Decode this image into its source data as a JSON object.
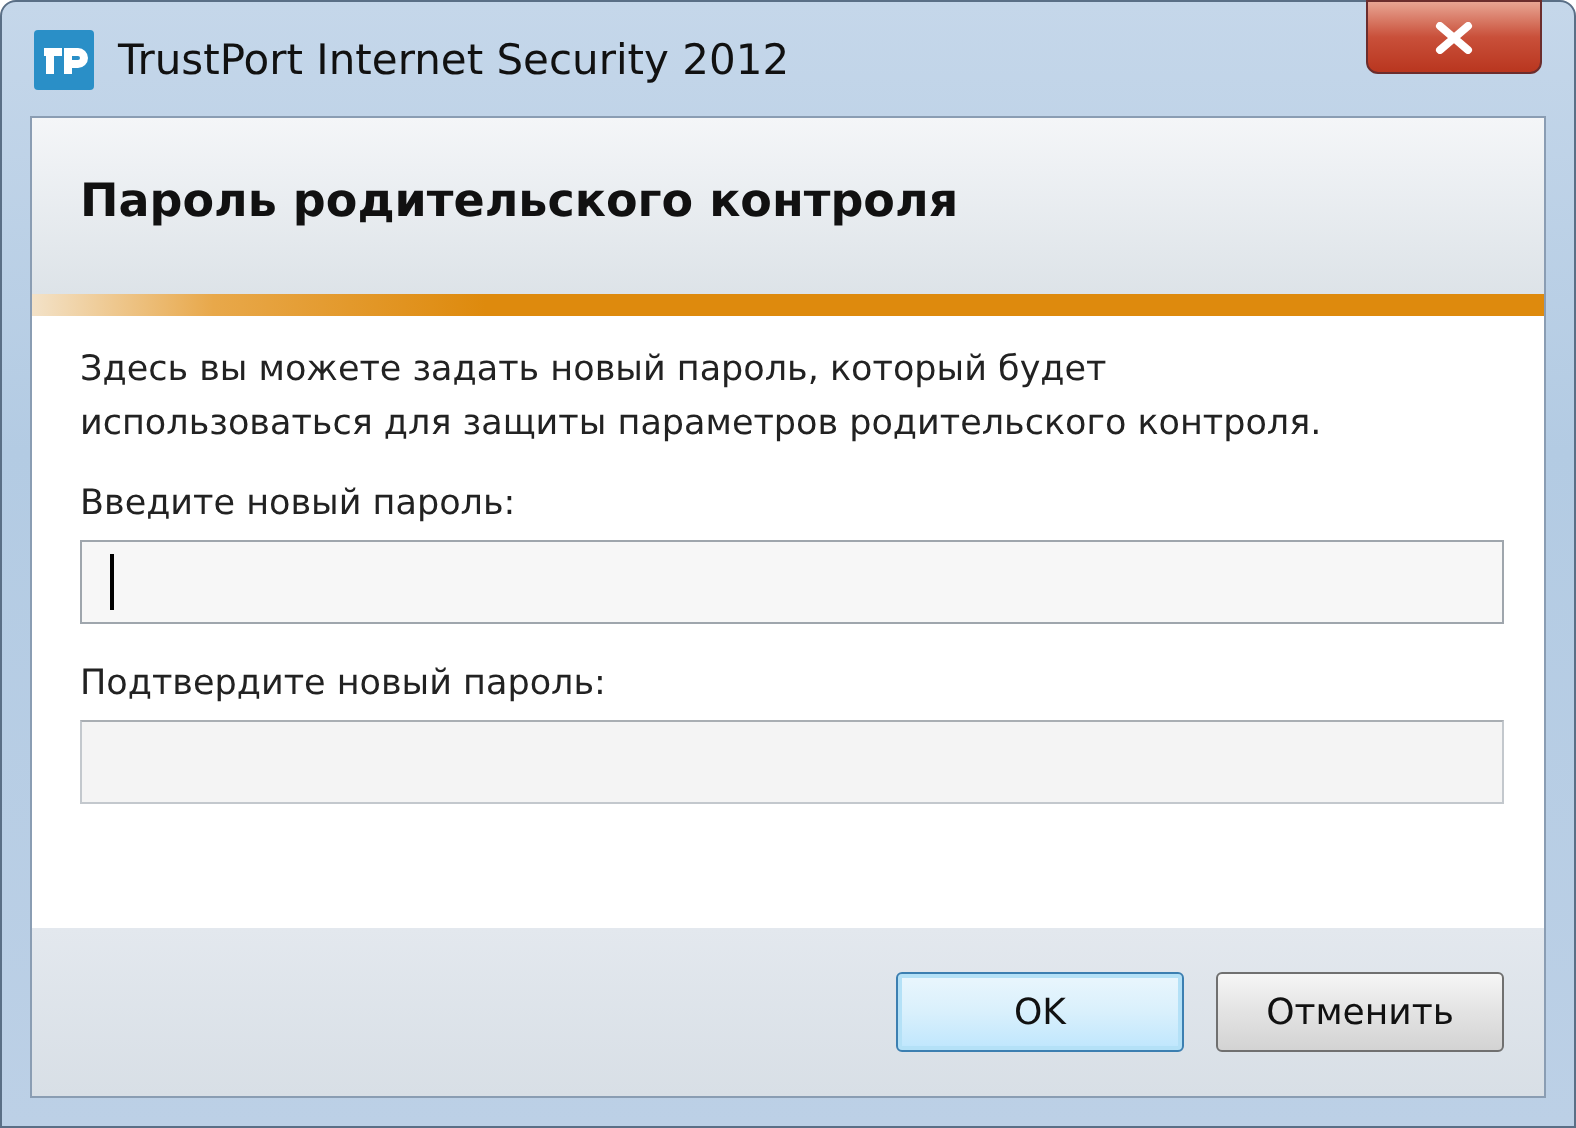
{
  "window": {
    "title": "TrustPort Internet Security 2012"
  },
  "header": {
    "title": "Пароль родительского контроля"
  },
  "description": "Здесь вы можете задать новый пароль, который будет использоваться для защиты параметров родительского контроля.",
  "fields": [
    {
      "label": "Введите новый пароль:",
      "focused": true
    },
    {
      "label": "Подтвердите новый пароль:",
      "focused": false
    }
  ],
  "buttons": [
    {
      "label": "OK",
      "default": true
    },
    {
      "label": "Отменить",
      "default": false
    }
  ]
}
